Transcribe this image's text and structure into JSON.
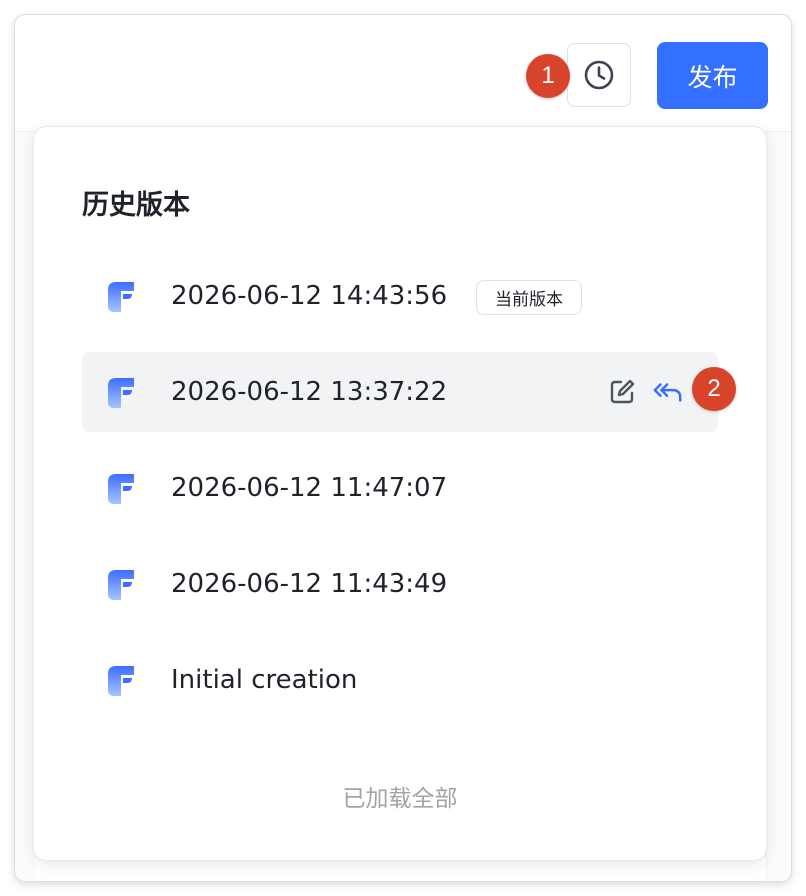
{
  "header": {
    "history_icon": "clock-icon",
    "publish_label": "发布",
    "accent_color": "#3370ff"
  },
  "markers": {
    "marker_1": "1",
    "marker_2": "2",
    "color": "#d8432b"
  },
  "history_panel": {
    "title": "历史版本",
    "versions": [
      {
        "label": "2026-06-12 14:43:56",
        "badge": "当前版本"
      },
      {
        "label": "2026-06-12 13:37:22",
        "actions": [
          "edit-icon",
          "restore-icon"
        ]
      },
      {
        "label": "2026-06-12 11:47:07"
      },
      {
        "label": "2026-06-12 11:43:49"
      },
      {
        "label": "Initial creation"
      }
    ],
    "footer_text": "已加载全部"
  }
}
